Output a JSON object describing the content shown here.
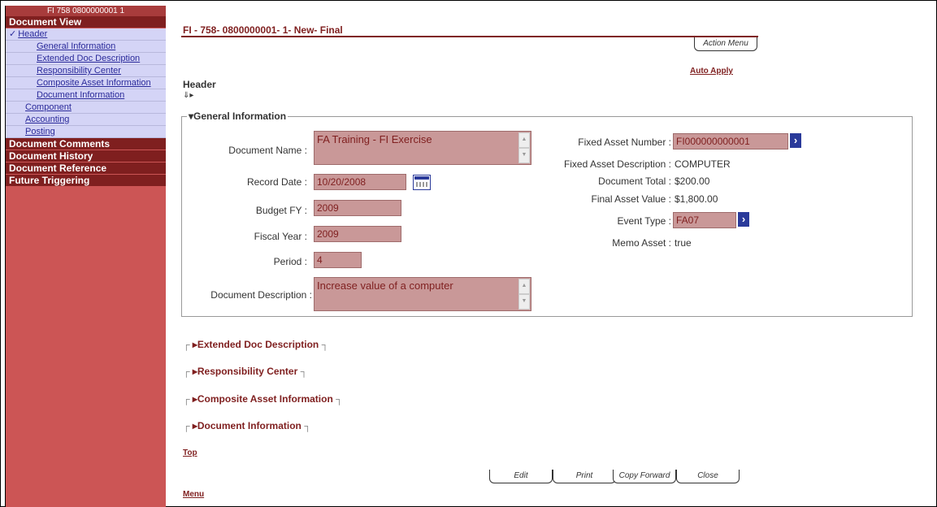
{
  "sidebar": {
    "title": "FI 758 0800000001 1",
    "document_view": "Document View",
    "items": [
      {
        "label": "Header"
      },
      {
        "label": "General Information"
      },
      {
        "label": "Extended Doc Description"
      },
      {
        "label": "Responsibility Center"
      },
      {
        "label": "Composite Asset Information"
      },
      {
        "label": "Document Information"
      },
      {
        "label": "Component"
      },
      {
        "label": "Accounting"
      },
      {
        "label": "Posting"
      }
    ],
    "sections": [
      "Document Comments",
      "Document History",
      "Document Reference",
      "Future Triggering"
    ]
  },
  "main": {
    "doc_title": "FI - 758- 0800000001- 1- New- Final",
    "action_menu": "Action Menu",
    "auto_apply": "Auto Apply",
    "header_label": "Header",
    "general_info": {
      "legend": "General Information",
      "document_name_label": "Document Name :",
      "document_name": "FA Training - FI Exercise",
      "record_date_label": "Record Date :",
      "record_date": "10/20/2008",
      "budget_fy_label": "Budget FY :",
      "budget_fy": "2009",
      "fiscal_year_label": "Fiscal Year :",
      "fiscal_year": "2009",
      "period_label": "Period :",
      "period": "4",
      "document_description_label": "Document Description :",
      "document_description": "Increase value of a computer",
      "fixed_asset_number_label": "Fixed Asset Number :",
      "fixed_asset_number": "FI000000000001",
      "fixed_asset_description_label": "Fixed Asset Description :",
      "fixed_asset_description": "COMPUTER",
      "document_total_label": "Document Total :",
      "document_total": "$200.00",
      "final_asset_value_label": "Final Asset Value :",
      "final_asset_value": "$1,800.00",
      "event_type_label": "Event Type :",
      "event_type": "FA07",
      "memo_asset_label": "Memo Asset :",
      "memo_asset": "true"
    },
    "collapsed_sections": [
      "Extended Doc Description",
      "Responsibility Center",
      "Composite Asset Information",
      "Document Information"
    ],
    "top_link": "Top",
    "menu_link": "Menu",
    "buttons": {
      "edit": "Edit",
      "print": "Print",
      "copy_forward": "Copy Forward",
      "close": "Close"
    }
  }
}
